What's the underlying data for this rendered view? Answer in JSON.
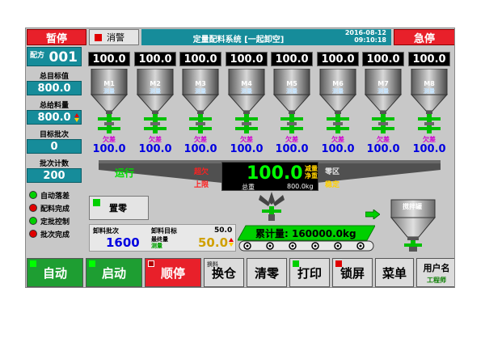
{
  "header": {
    "pause_label": "暂停",
    "mute_label": "消警",
    "title": "定量配料系统 [一起卸空]",
    "date": "2016-08-12",
    "time": "09:10:18",
    "estop_label": "急停"
  },
  "left_panel": {
    "recipe_label": "配方",
    "recipe_value": "001",
    "total_target_label": "总目标值",
    "total_target_value": "800.0",
    "total_feed_label": "总给料量",
    "total_feed_value": "800.0",
    "target_batch_label": "目标批次",
    "target_batch_value": "0",
    "batch_count_label": "批次计数",
    "batch_count_value": "200",
    "status": [
      {
        "label": "自动落差",
        "color": "#00d000"
      },
      {
        "label": "配料完成",
        "color": "#e00000"
      },
      {
        "label": "定批控制",
        "color": "#00d000"
      },
      {
        "label": "批次完成",
        "color": "#e00000"
      }
    ]
  },
  "bins": [
    {
      "weight": "100.0",
      "id": "M1",
      "mode": "测量",
      "state": "欠差",
      "value": "100.0"
    },
    {
      "weight": "100.0",
      "id": "M2",
      "mode": "测量",
      "state": "欠差",
      "value": "100.0"
    },
    {
      "weight": "100.0",
      "id": "M3",
      "mode": "测量",
      "state": "欠差",
      "value": "100.0"
    },
    {
      "weight": "100.0",
      "id": "M4",
      "mode": "测量",
      "state": "欠差",
      "value": "100.0"
    },
    {
      "weight": "100.0",
      "id": "M5",
      "mode": "测量",
      "state": "欠差",
      "value": "100.0"
    },
    {
      "weight": "100.0",
      "id": "M6",
      "mode": "测量",
      "state": "欠差",
      "value": "100.0"
    },
    {
      "weight": "100.0",
      "id": "M7",
      "mode": "测量",
      "state": "欠差",
      "value": "100.0"
    },
    {
      "weight": "100.0",
      "id": "M8",
      "mode": "测量",
      "state": "欠差",
      "value": "100.0"
    }
  ],
  "scale": {
    "run_label": "运行",
    "over_label": "超欠",
    "upper_label": "上限",
    "display_value": "100.0",
    "gross_label": "减量",
    "net_label": "净重",
    "total_label": "总重",
    "total_value": "800.0kg",
    "zero_label": "零区",
    "stable_label": "稳定"
  },
  "clear_button": "置零",
  "info": {
    "discharge_batch_label": "卸料批次",
    "discharge_batch_value": "1600",
    "discharge_target_label": "卸料目标",
    "discharge_target_value": "50.0",
    "final_label": "最终量",
    "final_mode": "测量",
    "final_value": "50.0"
  },
  "cumulative": "累计量: 160000.0kg",
  "mixer_label": "搅拌罐",
  "bottom": {
    "auto": "自动",
    "start": "启动",
    "stop": "顺停",
    "change_small": "换料",
    "change": "换仓",
    "clear": "清零",
    "print": "打印",
    "lock": "锁屏",
    "menu": "菜单",
    "username_label": "用户名",
    "username_value": "工程师"
  },
  "colors": {
    "teal": "#168c9a",
    "red": "#e8202a",
    "green": "#1e9e32",
    "value_blue": "#0000e0"
  }
}
